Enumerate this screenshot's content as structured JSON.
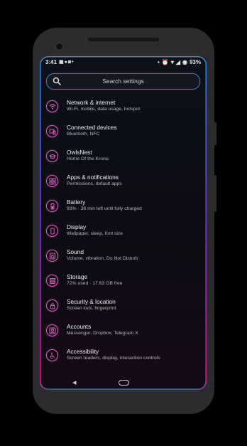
{
  "status_bar": {
    "time": "3:41",
    "left_icons": [
      "facebook-icon",
      "messenger-icon",
      "instagram-icon",
      "dot-icon"
    ],
    "battery_percent": "93%",
    "right_icons": [
      "dot-icon",
      "alarm-icon",
      "wifi-icon",
      "signal-icon",
      "battery-icon"
    ]
  },
  "search": {
    "placeholder": "Search settings"
  },
  "settings": [
    {
      "title": "Network & internet",
      "subtitle": "Wi-Fi, mobile, data usage, hotspot",
      "icon": "wifi-icon"
    },
    {
      "title": "Connected devices",
      "subtitle": "Bluetooth, NFC",
      "icon": "devices-icon"
    },
    {
      "title": "OwlsNest",
      "subtitle": "Home Of the Kronic",
      "icon": "owl-icon"
    },
    {
      "title": "Apps & notifications",
      "subtitle": "Permissions, default apps",
      "icon": "apps-icon"
    },
    {
      "title": "Battery",
      "subtitle": "93% · 38 min left until fully charged",
      "icon": "battery-icon"
    },
    {
      "title": "Display",
      "subtitle": "Wallpaper, sleep, font size",
      "icon": "display-icon"
    },
    {
      "title": "Sound",
      "subtitle": "Volume, vibration, Do Not Disturb",
      "icon": "sound-icon"
    },
    {
      "title": "Storage",
      "subtitle": "72% used · 17.63 GB free",
      "icon": "storage-icon"
    },
    {
      "title": "Security & location",
      "subtitle": "Screen lock, fingerprint",
      "icon": "lock-icon"
    },
    {
      "title": "Accounts",
      "subtitle": "Messenger, Dropbox, Telegram X",
      "icon": "account-icon"
    },
    {
      "title": "Accessibility",
      "subtitle": "Screen readers, display, interaction controls",
      "icon": "accessibility-icon"
    }
  ],
  "navbar": {
    "back_icon": "back-icon",
    "home_icon": "home-icon"
  },
  "colors": {
    "accent_pink": "#e060c0",
    "accent_blue": "#2e8de0",
    "background": "#0c1118"
  }
}
